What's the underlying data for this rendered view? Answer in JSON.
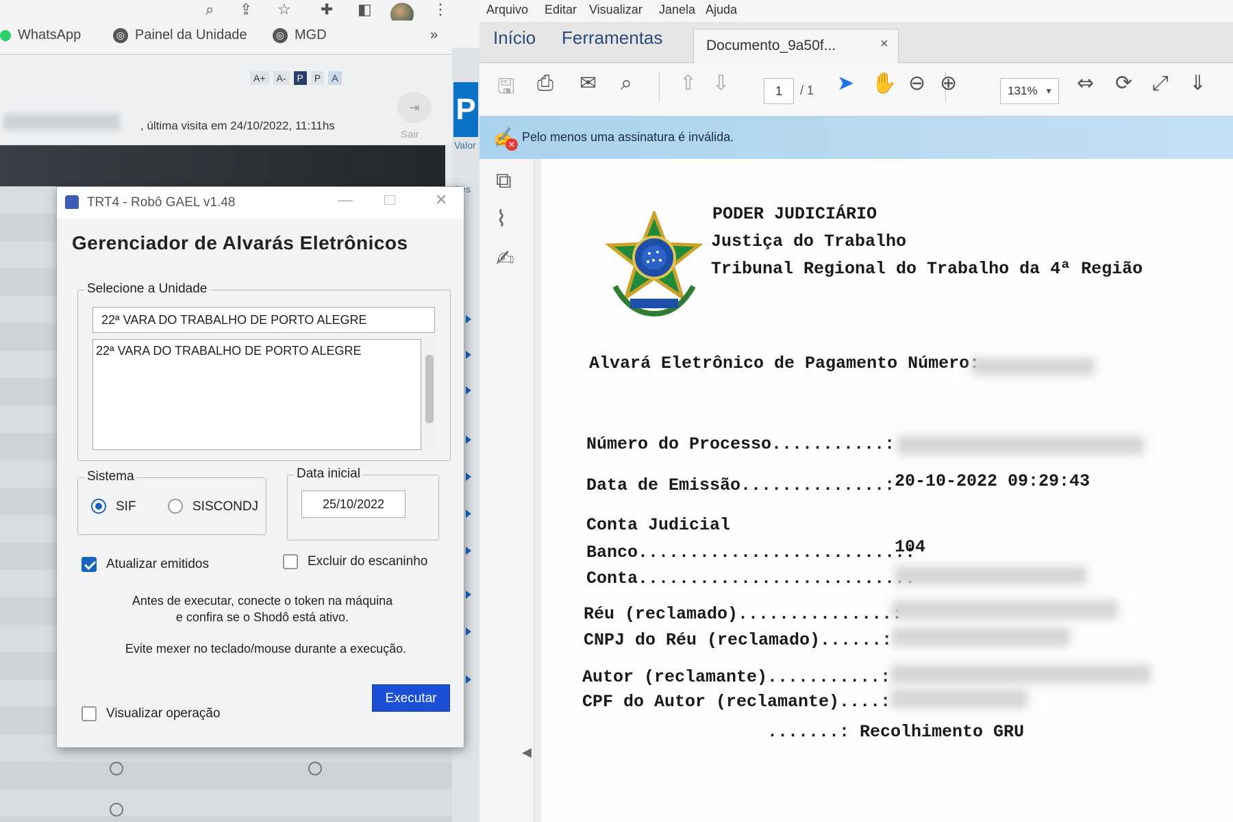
{
  "browser": {
    "bookmarks": [
      {
        "label": "WhatsApp"
      },
      {
        "label": "Painel da Unidade"
      },
      {
        "label": "MGD"
      }
    ],
    "bookmarks_overflow": "»",
    "font_tools": [
      "A+",
      "A-",
      "P",
      "P",
      "A"
    ],
    "last_visit": ", última visita em 24/10/2022, 11:11hs",
    "logout_label": "Sair",
    "side_labels": [
      "Valor",
      "Pes"
    ]
  },
  "dialog": {
    "title": "TRT4 - Robô GAEL v1.48",
    "heading": "Gerenciador de Alvarás Eletrônicos",
    "unit_group_label": "Selecione a Unidade",
    "unit_input_value": "22ª VARA DO TRABALHO DE PORTO ALEGRE",
    "unit_list": [
      "22ª VARA DO TRABALHO DE PORTO ALEGRE"
    ],
    "system_group_label": "Sistema",
    "system_options": [
      {
        "label": "SIF",
        "selected": true
      },
      {
        "label": "SISCONDJ",
        "selected": false
      }
    ],
    "date_group_label": "Data inicial",
    "date_value": "25/10/2022",
    "checkbox_update": {
      "label": "Atualizar emitidos",
      "checked": true
    },
    "checkbox_remove": {
      "label": "Excluir do escaninho",
      "checked": false
    },
    "note_line1": "Antes de executar, conecte o token na máquina",
    "note_line2": "e confira se o Shodô está ativo.",
    "note_line3": "Evite mexer no teclado/mouse durante a execução.",
    "checkbox_view": {
      "label": "Visualizar operação",
      "checked": false
    },
    "run_button": "Executar",
    "accent_color": "#1a4fd6"
  },
  "reader": {
    "menu": [
      "Arquivo",
      "Editar",
      "Visualizar",
      "Janela",
      "Ajuda"
    ],
    "tabs": [
      "Início",
      "Ferramentas"
    ],
    "document_tab": "Documento_9a50f...",
    "document_tab_close": "×",
    "page_current": "1",
    "page_total": "/ 1",
    "zoom": "131%",
    "signature_message": "Pelo menos uma assinatura é inválida.",
    "signature_bar_color": "#a9d2ee"
  },
  "document": {
    "header_line1": "PODER JUDICIÁRIO",
    "header_line2": "Justiça do Trabalho",
    "header_line3": "Tribunal Regional do Trabalho da 4ª Região",
    "alvara_title": "Alvará Eletrônico de Pagamento Número:",
    "fields": [
      {
        "label": "Número do Processo...........:",
        "value": ""
      },
      {
        "label": "Data de Emissão..............:",
        "value": "20-10-2022 09:29:43"
      }
    ],
    "conta_judicial": "Conta Judicial",
    "banco_label": "Banco..........................:",
    "banco_value": "104",
    "conta_label": "Conta..........................:",
    "reu_label": "Réu (reclamado)...............:",
    "cnpj_label": "CNPJ do Réu (reclamado)......:",
    "autor_label": "Autor (reclamante)...........:",
    "cpf_label": "CPF do Autor (reclamante)....:",
    "last_line": ".......: Recolhimento GRU"
  }
}
